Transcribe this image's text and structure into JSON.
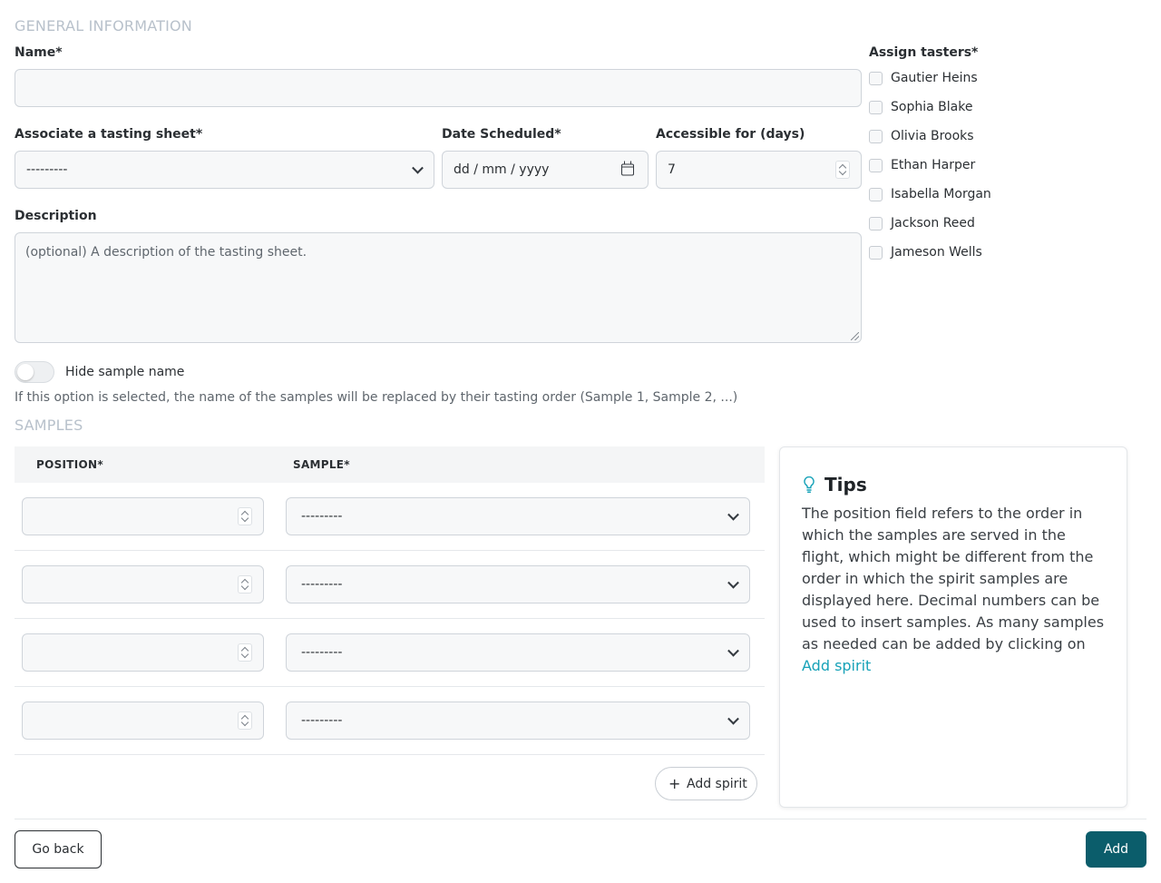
{
  "general": {
    "section_title": "GENERAL INFORMATION",
    "name_label": "Name*",
    "name_value": "",
    "sheet_label": "Associate a tasting sheet*",
    "sheet_value": "---------",
    "date_label": "Date Scheduled*",
    "date_placeholder": "dd / mm / yyyy",
    "days_label": "Accessible for (days)",
    "days_value": "7",
    "description_label": "Description",
    "description_placeholder": "(optional) A description of the tasting sheet.",
    "hide_label": "Hide sample name",
    "hide_checked": false,
    "hide_help": "If this option is selected, the name of the samples will be replaced by their tasting order (Sample 1, Sample 2, ...)"
  },
  "tasters": {
    "label": "Assign tasters*",
    "items": [
      {
        "name": "Gautier Heins",
        "checked": false
      },
      {
        "name": "Sophia Blake",
        "checked": false
      },
      {
        "name": "Olivia Brooks",
        "checked": false
      },
      {
        "name": "Ethan Harper",
        "checked": false
      },
      {
        "name": "Isabella Morgan",
        "checked": false
      },
      {
        "name": "Jackson Reed",
        "checked": false
      },
      {
        "name": "Jameson Wells",
        "checked": false
      }
    ]
  },
  "samples": {
    "section_title": "SAMPLES",
    "col_position": "POSITION*",
    "col_sample": "SAMPLE*",
    "rows": [
      {
        "position": "",
        "sample": "---------"
      },
      {
        "position": "",
        "sample": "---------"
      },
      {
        "position": "",
        "sample": "---------"
      },
      {
        "position": "",
        "sample": "---------"
      }
    ],
    "add_spirit_label": "Add spirit"
  },
  "tips": {
    "title": "Tips",
    "icon": "lightbulb-icon",
    "body": "The position field refers to the order in which the samples are served in the flight, which might be different from the order in which the spirit samples are displayed here. Decimal numbers can be used to insert samples. As many samples as needed can be added by clicking on",
    "link": "Add spirit"
  },
  "footer": {
    "back_label": "Go back",
    "add_label": "Add"
  },
  "colors": {
    "primary": "#0b5d6b",
    "link": "#17a2b8",
    "section_title": "#b8c1cb"
  }
}
